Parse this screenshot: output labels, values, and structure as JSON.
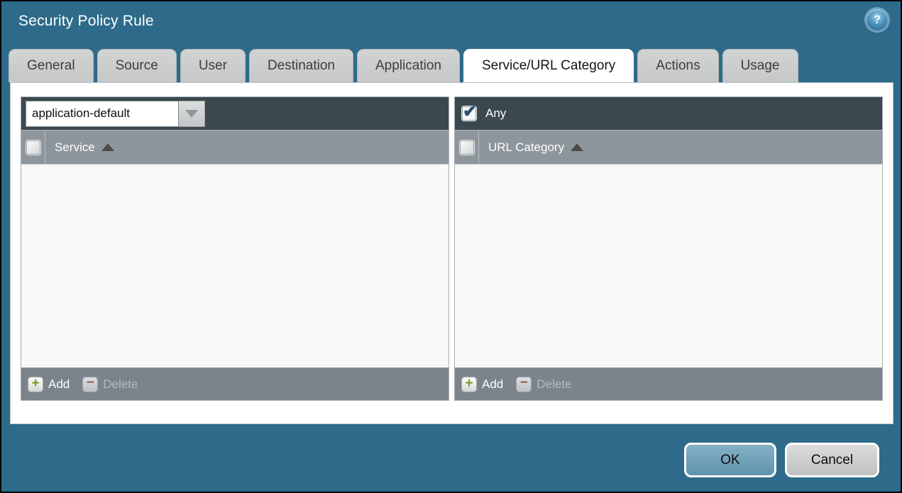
{
  "dialog": {
    "title": "Security Policy Rule"
  },
  "icons": {
    "help": "?",
    "dropdown_arrow": "triangle-down",
    "sort_ascending": "triangle-up",
    "add": "+",
    "delete": "−",
    "checkmark": "✔"
  },
  "tabs": [
    {
      "label": "General",
      "active": false
    },
    {
      "label": "Source",
      "active": false
    },
    {
      "label": "User",
      "active": false
    },
    {
      "label": "Destination",
      "active": false
    },
    {
      "label": "Application",
      "active": false
    },
    {
      "label": "Service/URL Category",
      "active": true
    },
    {
      "label": "Actions",
      "active": false
    },
    {
      "label": "Usage",
      "active": false
    }
  ],
  "service_panel": {
    "combo_value": "application-default",
    "column_header": "Service",
    "sort": "ascending",
    "rows": [],
    "add_label": "Add",
    "delete_label": "Delete",
    "delete_enabled": false
  },
  "url_category_panel": {
    "any_label": "Any",
    "any_checked": true,
    "column_header": "URL Category",
    "sort": "ascending",
    "rows": [],
    "add_label": "Add",
    "delete_label": "Delete",
    "delete_enabled": false
  },
  "footer": {
    "ok_label": "OK",
    "cancel_label": "Cancel"
  },
  "colors": {
    "dialog_background": "#2e6b8a",
    "toolbar_dark": "#3b4850",
    "header_gray": "#8d969c",
    "footer_gray": "#7b848b",
    "body_light": "#f7f8f7",
    "tab_inactive": "#c9cbca",
    "tab_active": "#ffffff",
    "ok_button": "#6fa0b8",
    "cancel_button": "#c9cacc",
    "add_icon_green": "#7d9b1e",
    "delete_icon_red": "#9c4f3c"
  }
}
